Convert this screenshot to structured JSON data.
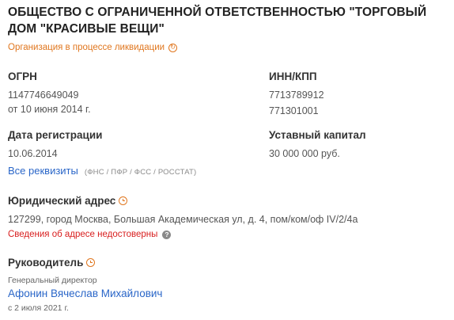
{
  "company": {
    "title": "ОБЩЕСТВО С ОГРАНИЧЕННОЙ ОТВЕТСТВЕННОСТЬЮ \"ТОРГОВЫЙ ДОМ \"КРАСИВЫЕ ВЕЩИ\"",
    "status": "Организация в процессе ликвидации"
  },
  "ogrn": {
    "label": "ОГРН",
    "value": "1147746649049",
    "date": "от 10 июня 2014 г."
  },
  "inn_kpp": {
    "label": "ИНН/КПП",
    "inn": "7713789912",
    "kpp": "771301001"
  },
  "registration": {
    "label": "Дата регистрации",
    "value": "10.06.2014"
  },
  "capital": {
    "label": "Уставный капитал",
    "value": "30 000 000 руб."
  },
  "requisites": {
    "link": "Все реквизиты",
    "sources": "(ФНС / ПФР / ФСС / РОССТАТ)"
  },
  "address": {
    "label": "Юридический адрес",
    "value": "127299, город Москва, Большая Академическая ул, д. 4, пом/ком/оф IV/2/4а",
    "warning": "Сведения об адресе недостоверны"
  },
  "head": {
    "label": "Руководитель",
    "position": "Генеральный директор",
    "name": "Афонин Вячеслав Михайлович",
    "since": "с 2 июля 2021 г."
  },
  "colors": {
    "accent": "#e0761e",
    "link": "#2a66c8",
    "warning": "#d81e1e"
  },
  "icons": {
    "status": "refresh-clock-icon",
    "address": "clock-icon",
    "warning": "question-icon",
    "head": "clock-icon"
  }
}
